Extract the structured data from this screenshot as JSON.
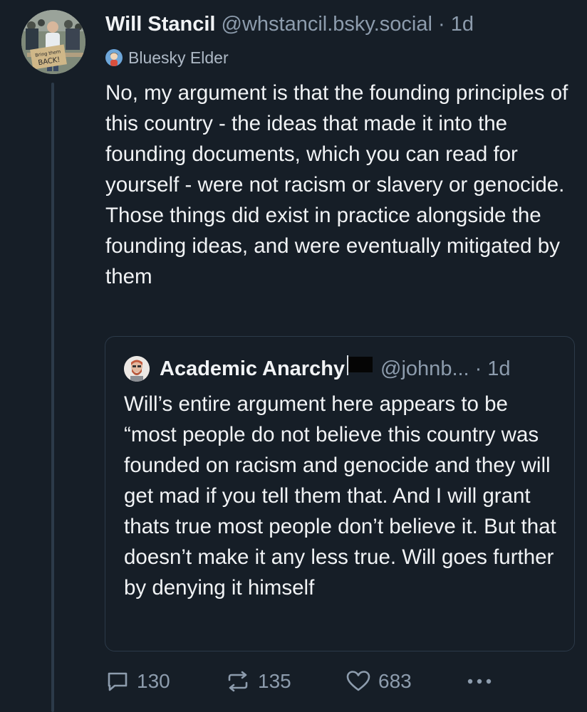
{
  "post": {
    "author": {
      "display_name": "Will Stancil",
      "handle": "@whstancil.bsky.social",
      "separator": "·",
      "time": "1d",
      "avatar_sign_text": [
        "Bring them",
        "BACK!"
      ],
      "badge_label": "Bluesky Elder"
    },
    "text": "No, my argument is that the founding principles of this country - the ideas that made it into the founding documents, which you can read for yourself - were not racism or slavery or genocide. Those things did exist in practice alongside the founding ideas, and were eventually mitigated by them",
    "quote": {
      "display_name": "Academic Anarchy",
      "flag": "🏴",
      "handle": "@johnb...",
      "separator": "·",
      "time": "1d",
      "text": "Will’s entire argument here appears to be “most people do not believe this country was founded on racism and genocide and they will get mad if you tell them that. And I will grant thats true most people don’t believe it. But that doesn’t make it any less true. Will goes further by denying it himself"
    },
    "actions": {
      "replies": "130",
      "reposts": "135",
      "likes": "683",
      "more_icon": "ellipsis-icon"
    }
  },
  "colors": {
    "background": "#161e27",
    "text": "#f1f3f5",
    "muted": "#8d9cad",
    "border": "#2c3a49"
  }
}
